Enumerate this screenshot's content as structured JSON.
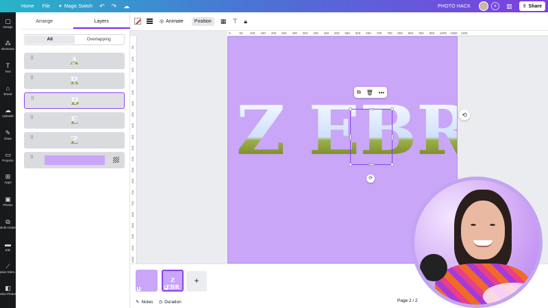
{
  "topbar": {
    "home": "Home",
    "file": "File",
    "magic_switch": "Magic Switch",
    "project_name": "PHOTO HACK",
    "share": "Share"
  },
  "rail": [
    {
      "icon": "▢",
      "label": "Design"
    },
    {
      "icon": "⁂",
      "label": "Elements"
    },
    {
      "icon": "T",
      "label": "Text"
    },
    {
      "icon": "⌂",
      "label": "Brand"
    },
    {
      "icon": "☁",
      "label": "Uploads"
    },
    {
      "icon": "✎",
      "label": "Draw"
    },
    {
      "icon": "▭",
      "label": "Projects"
    },
    {
      "icon": "⊞",
      "label": "Apps"
    },
    {
      "icon": "▣",
      "label": "Photos"
    },
    {
      "icon": "⧉",
      "label": "Bulk create"
    },
    {
      "icon": "▬",
      "label": "Elle"
    },
    {
      "icon": "⟋",
      "label": "ative Elem..."
    },
    {
      "icon": "◧",
      "label": "ultra Photos"
    }
  ],
  "panel": {
    "tab_arrange": "Arrange",
    "tab_layers": "Layers",
    "filter_all": "All",
    "filter_overlapping": "Overlapping",
    "layers": [
      "A",
      "R",
      "B",
      "E",
      "Z"
    ]
  },
  "toolbar": {
    "animate": "Animate",
    "position": "Position"
  },
  "ruler_top": [
    "0",
    "50",
    "100",
    "150",
    "200",
    "250",
    "300",
    "350",
    "400",
    "450",
    "500",
    "550",
    "600",
    "650",
    "700",
    "750",
    "800",
    "850",
    "900",
    "950",
    "1000",
    "1050",
    "1100"
  ],
  "ruler_left": [
    "50",
    "100",
    "150",
    "200",
    "250",
    "300",
    "350",
    "400",
    "450",
    "500",
    "550",
    "600",
    "650",
    "700",
    "750",
    "800",
    "850",
    "900",
    "950",
    "1000"
  ],
  "canvas": {
    "word": "Z EBRA"
  },
  "thumbs": {
    "t1_num": "1",
    "t2_text": "Z EBR",
    "t2_num": "2",
    "add": "+"
  },
  "bottombar": {
    "notes": "Notes",
    "duration": "Duration",
    "page": "Page 2 / 2"
  },
  "colors": {
    "accent": "#8b3ff0",
    "page_bg": "#c9a6f7"
  }
}
